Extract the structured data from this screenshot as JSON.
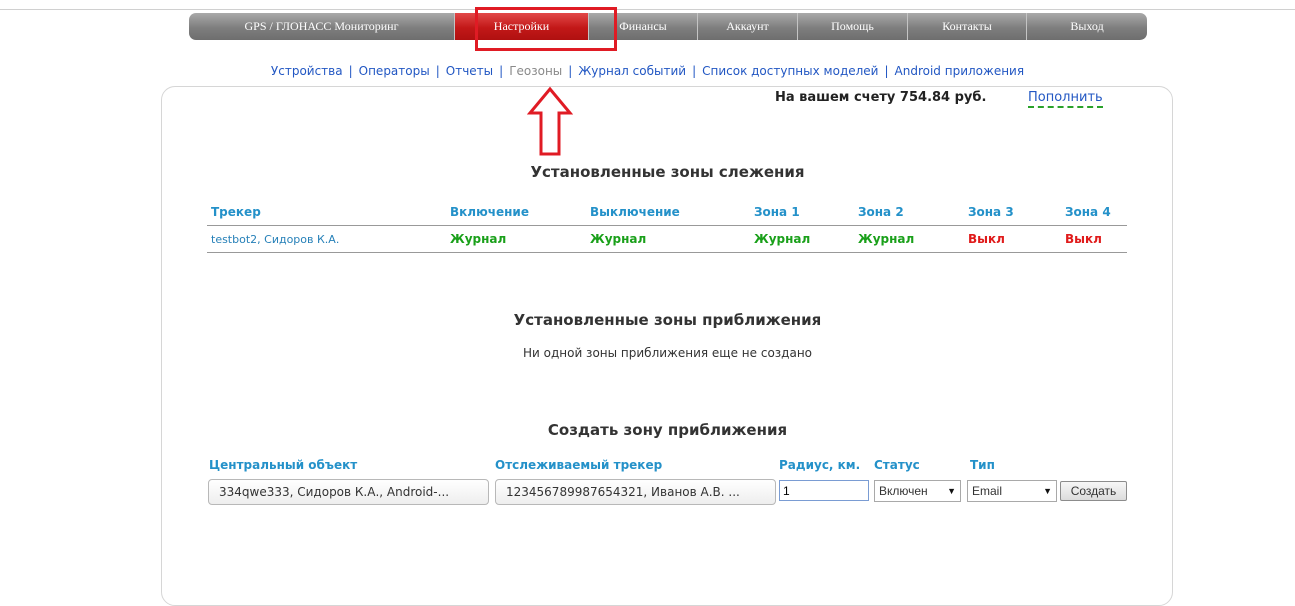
{
  "nav": {
    "items": [
      {
        "label": "GPS / ГЛОНАСС Мониторинг"
      },
      {
        "label": "Настройки"
      },
      {
        "label": "Финансы"
      },
      {
        "label": "Аккаунт"
      },
      {
        "label": "Помощь"
      },
      {
        "label": "Контакты"
      },
      {
        "label": "Выход"
      }
    ],
    "active_color": "#c21818"
  },
  "subnav": {
    "items": [
      {
        "label": "Устройства"
      },
      {
        "label": "Операторы"
      },
      {
        "label": "Отчеты"
      },
      {
        "label": "Геозоны"
      },
      {
        "label": "Журнал событий"
      },
      {
        "label": "Список доступных моделей"
      },
      {
        "label": "Android приложения"
      }
    ],
    "separator": "|"
  },
  "account": {
    "balance_text": "На вашем счету 754.84 руб.",
    "topup_label": "Пополнить"
  },
  "tracking_zones": {
    "title": "Установленные зоны слежения",
    "columns": [
      "Трекер",
      "Включение",
      "Выключение",
      "Зона 1",
      "Зона 2",
      "Зона 3",
      "Зона 4"
    ],
    "rows": [
      {
        "tracker": "testbot2, Сидоров К.А.",
        "on": "Журнал",
        "off": "Журнал",
        "zone1": "Журнал",
        "zone2": "Журнал",
        "zone3": "Выкл",
        "zone4": "Выкл"
      }
    ]
  },
  "approach_zones": {
    "title": "Установленные зоны приближения",
    "empty_message": "Ни одной зоны приближения еще не создано"
  },
  "create_zone": {
    "title": "Создать зону приближения",
    "labels": {
      "central_object": "Центральный объект",
      "tracked_tracker": "Отслеживаемый трекер",
      "radius": "Радиус, км.",
      "status": "Статус",
      "type": "Тип"
    },
    "central_object_value": "334qwe333, Сидоров К.А., Android-...",
    "tracked_tracker_value": "123456789987654321, Иванов А.В. ...",
    "radius_value": "1",
    "status_value": "Включен",
    "type_value": "Email",
    "create_button": "Создать"
  },
  "colors": {
    "accent_blue": "#2491c9",
    "link_blue": "#2257c3",
    "status_green": "#1aa01a",
    "status_red": "#e01b1b",
    "annotation_red": "#e01b24"
  }
}
